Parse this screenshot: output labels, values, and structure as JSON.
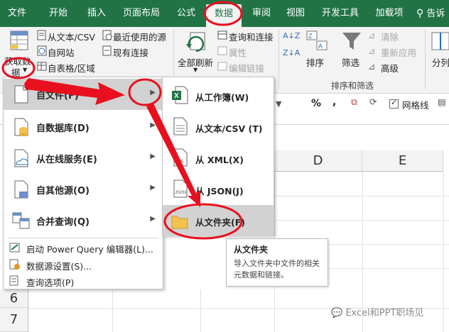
{
  "ribbon_tabs": [
    "文件",
    "开始",
    "插入",
    "页面布局",
    "公式",
    "数据",
    "审阅",
    "视图",
    "开发工具",
    "加载项"
  ],
  "tell_me": "告诉",
  "get_data": {
    "line1": "获取数",
    "line2": "据"
  },
  "group_get": {
    "from_text_csv": "从文本/CSV",
    "from_web": "自网站",
    "from_table": "自表格/区域",
    "recent_sources": "最近使用的源",
    "existing_connections": "现有连接"
  },
  "group_queries": {
    "refresh_all": "全部刷新",
    "queries_connections": "查询和连接",
    "properties": "属性",
    "edit_links": "编辑链接"
  },
  "group_sort": {
    "sort": "排序",
    "filter": "筛选",
    "clear": "清除",
    "reapply": "重新应用",
    "advanced": "高级",
    "group_label": "排序和筛选"
  },
  "split": "分列",
  "toolbar": {
    "percent": "%",
    "comma": ",",
    "gridlines": "网格线"
  },
  "columns": [
    "D",
    "E"
  ],
  "rows": [
    "6",
    "7"
  ],
  "menu": {
    "items": [
      "自文件(F)",
      "自数据库(D)",
      "从在线服务(E)",
      "自其他源(O)",
      "合并查询(Q)"
    ],
    "small_items": [
      "启动 Power Query 编辑器(L)...",
      "数据源设置(S)...",
      "查询选项(P)"
    ]
  },
  "submenu": {
    "items": [
      "从工作簿(W)",
      "从文本/CSV (T)",
      "从 XML(X)",
      "从 JSON(J)",
      "从文件夹(F)"
    ]
  },
  "tooltip": {
    "title": "从文件夹",
    "desc": "导入文件夹中文件的相关元数据和链接。"
  },
  "watermark": "Excel和PPT职场见",
  "colors": {
    "excel_green": "#217346",
    "annotation_red": "#e8101e",
    "folder_yellow": "#f2c14e"
  }
}
